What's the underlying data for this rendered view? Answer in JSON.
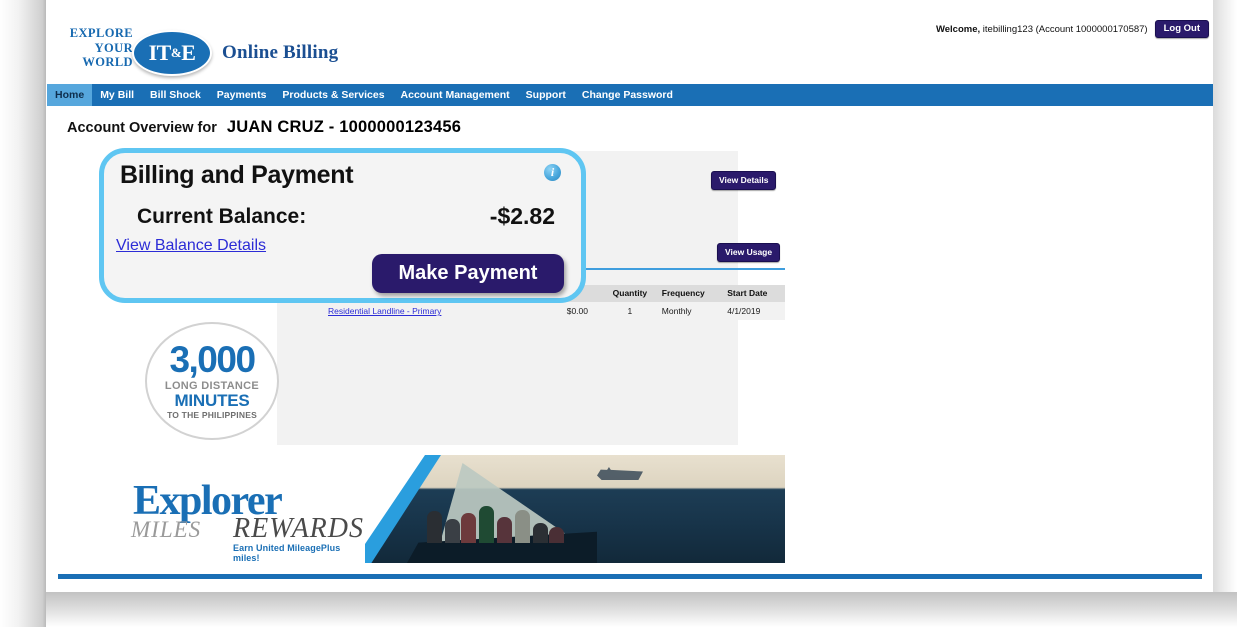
{
  "brand": {
    "tagline_line1": "EXPLORE",
    "tagline_line2": "YOUR",
    "tagline_line3": "WORLD",
    "logo_left": "IT",
    "logo_amp": "&",
    "logo_right": "E",
    "site_title": "Online Billing",
    "primary_blue": "#1a6fb5",
    "nav_blue": "#1a6fb5",
    "active_tab_blue": "#56a7dd",
    "button_purple": "#2a1a6b",
    "link_blue": "#2c2cd6",
    "highlight_cyan": "#5fc6f2"
  },
  "header": {
    "welcome_label": "Welcome,",
    "welcome_user": " itebilling123 (Account 1000000170587)",
    "logout_label": "Log Out"
  },
  "nav": {
    "items": [
      {
        "label": "Home",
        "active": true
      },
      {
        "label": "My Bill",
        "active": false
      },
      {
        "label": "Bill Shock",
        "active": false
      },
      {
        "label": "Payments",
        "active": false
      },
      {
        "label": "Products & Services",
        "active": false
      },
      {
        "label": "Account Management",
        "active": false
      },
      {
        "label": "Support",
        "active": false
      },
      {
        "label": "Change Password",
        "active": false
      }
    ]
  },
  "overview": {
    "label": "Account Overview for",
    "account": "JUAN CRUZ - 1000000123456"
  },
  "billing_card": {
    "heading": "Billing and Payment",
    "info_icon_glyph": "i",
    "balance_label": "Current Balance:",
    "balance_value": "-$2.82",
    "view_balance_link": "View Balance Details",
    "make_payment_label": "Make Payment"
  },
  "panel_buttons": {
    "view_details": "View Details",
    "view_usage": "View Usage"
  },
  "services_table": {
    "columns": [
      "",
      "",
      "Quantity",
      "Frequency",
      "Start Date"
    ],
    "rows": [
      {
        "service": "Residential Landline - Primary",
        "charge": "$0.00",
        "quantity": "1",
        "frequency": "Monthly",
        "start_date": "4/1/2019"
      }
    ]
  },
  "minutes_badge": {
    "number": "3,000",
    "line1": "LONG DISTANCE",
    "line2": "MINUTES",
    "line3": "TO THE PHILIPPINES"
  },
  "explorer_banner": {
    "word_explorer": "Explorer",
    "word_miles": "MILES",
    "word_rewards": "REWARDS",
    "tagline": "Earn United MileagePlus miles!"
  }
}
